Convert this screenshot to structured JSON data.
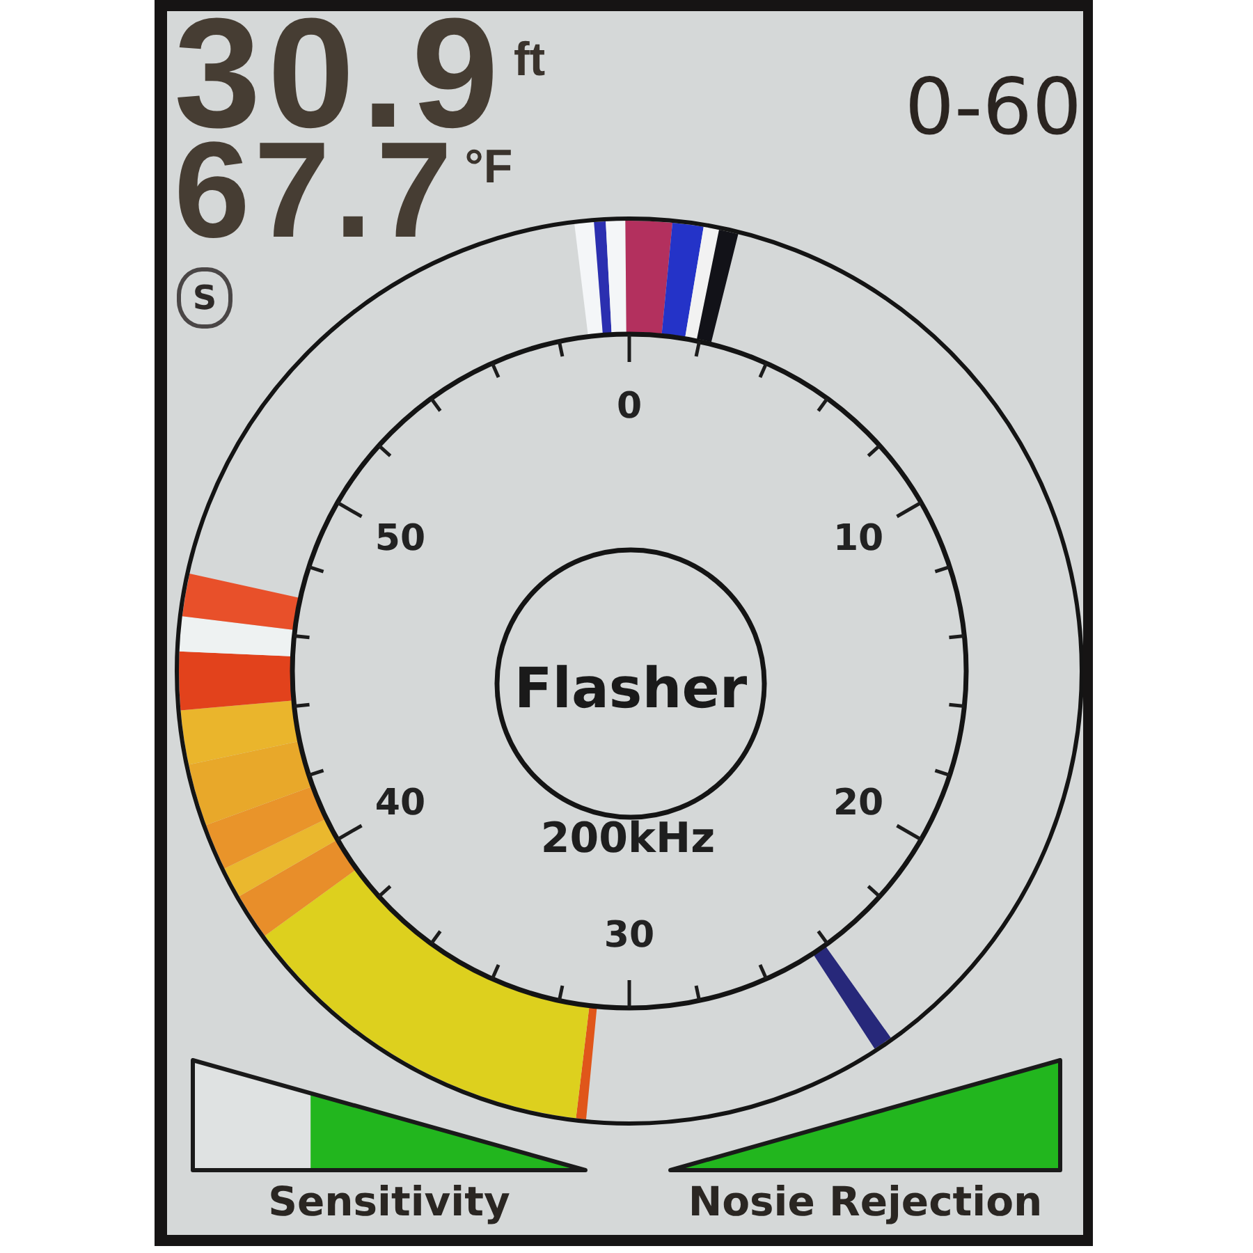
{
  "readings": [
    {
      "value": "30.9",
      "unit": "ft"
    },
    {
      "value": "67.7",
      "unit": "°F"
    }
  ],
  "mode_indicator": "S",
  "range": "0-60",
  "dial": {
    "scale_labels": [
      "0",
      "10",
      "20",
      "30",
      "40",
      "50"
    ],
    "title": "Flasher",
    "frequency": "200kHz"
  },
  "gauges": [
    {
      "label": "Sensitivity",
      "level": 0.7
    },
    {
      "label": "Nosie Rejection",
      "level": 1
    }
  ]
}
